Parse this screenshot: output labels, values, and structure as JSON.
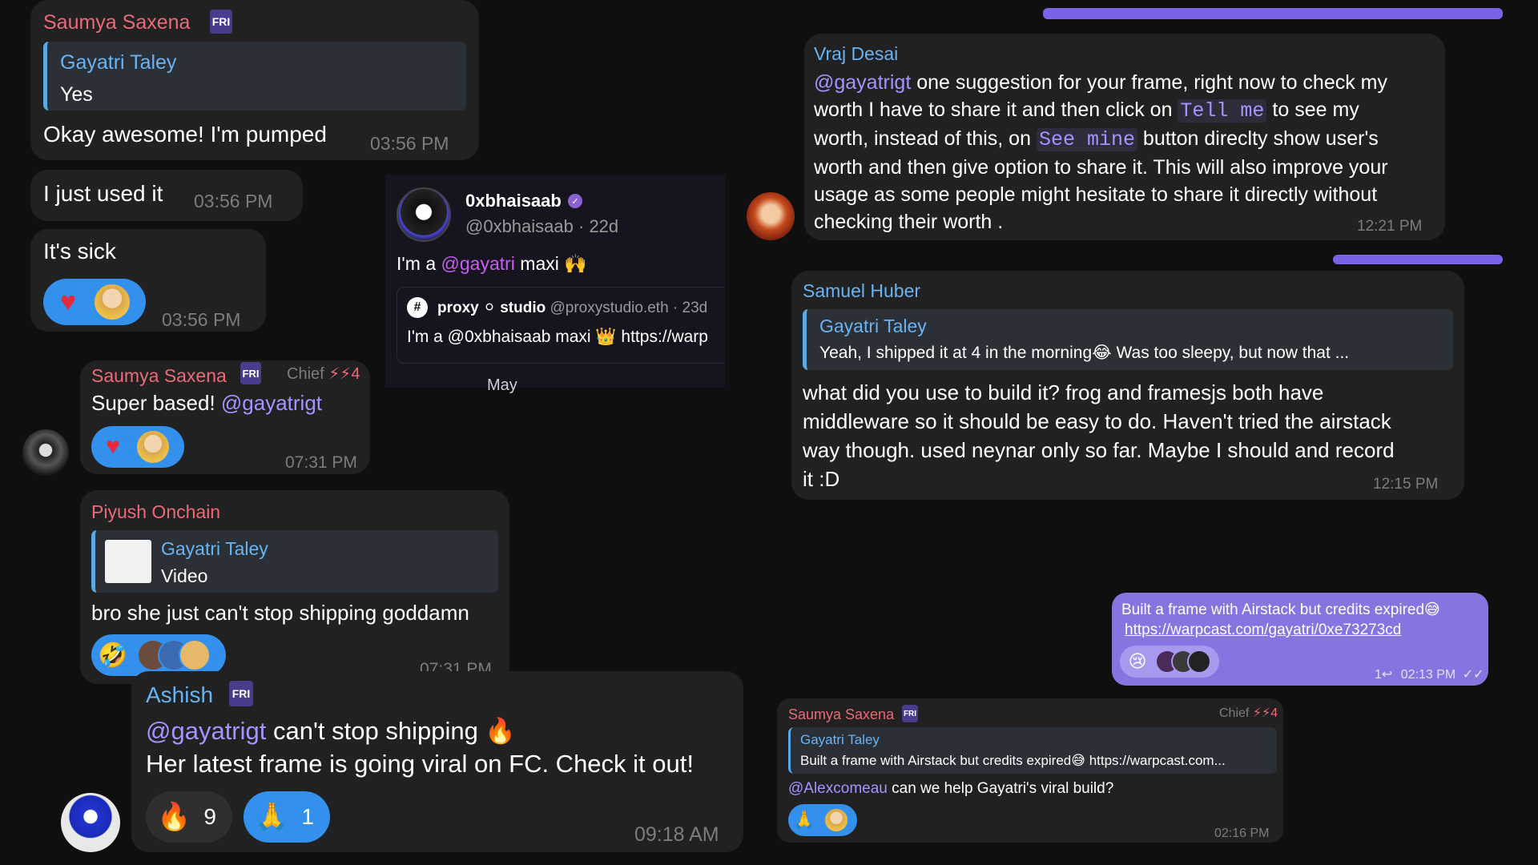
{
  "left": {
    "m1": {
      "name": "Saumya Saxena",
      "reply_name": "Gayatri Taley",
      "reply_text": "Yes",
      "text": "Okay awesome! I'm pumped",
      "time": "03:56 PM"
    },
    "m2": {
      "text": "I just used it",
      "time": "03:56 PM"
    },
    "m3": {
      "text": "It's sick",
      "time": "03:56 PM",
      "reactions": [
        "heart-emoji",
        "avatar-gayatri"
      ]
    },
    "m4": {
      "name": "Saumya Saxena",
      "tag": "Chief",
      "tag_suffix": "4",
      "text": "Super based!",
      "mention": "@gayatrigt",
      "time": "07:31 PM",
      "reactions": [
        "heart-emoji",
        "avatar-gayatri"
      ]
    },
    "m5": {
      "name": "Piyush Onchain",
      "reply_name": "Gayatri Taley",
      "reply_text": "Video",
      "text": "bro she just can't stop shipping goddamn",
      "time": "07:31 PM",
      "reactions": [
        "rofl-emoji",
        "avatar-stack"
      ]
    },
    "m6": {
      "name": "Ashish",
      "mention": "@gayatrigt",
      "line1": "can't stop shipping 🔥",
      "line2": "Her latest frame is going viral on FC. Check it out!",
      "time": "09:18 AM",
      "r1_emoji": "🔥",
      "r1_count": "9",
      "r2_emoji": "🙏",
      "r2_count": "1"
    }
  },
  "cast": {
    "author": "0xbhaisaab",
    "handle": "@0xbhaisaab",
    "age": "22d",
    "text_pre": "I'm a ",
    "mention": "@gayatri",
    "text_post": " maxi 🙌",
    "quote_author": "proxy ⚪ studio",
    "quote_handle": "@proxystudio.eth",
    "quote_age": "23d",
    "quote_text": "I'm a @0xbhaisaab maxi 👑 https://warp",
    "below_text": "May"
  },
  "right": {
    "m1": {
      "name": "Vraj Desai",
      "mention": "@gayatrigt",
      "t1": " one suggestion for your frame, right now to check my",
      "t2a": "worth I have to share it and then click on ",
      "code1": "Tell me",
      "t2b": " to see my",
      "t3a": "worth, instead of this, on ",
      "code2": "See mine",
      "t3b": " button direclty show user's",
      "t4": "worth and then give option to share it. This will also improve your",
      "t5": "usage as some people might hesitate to share it directly without",
      "t6": "checking their worth .",
      "time": "12:21 PM"
    },
    "m2": {
      "name": "Samuel Huber",
      "reply_name": "Gayatri Taley",
      "reply_text": "Yeah, I shipped it at 4 in the morning😂 Was too sleepy, but now that ...",
      "l1": "what did you use to build it? frog and framesjs both have",
      "l2": "middleware so it should be easy to do. Haven't tried the airstack",
      "l3": "way though. used neynar only so far. Maybe I should and record",
      "l4": "it :D",
      "time": "12:15 PM"
    },
    "m3": {
      "text": "Built a frame with Airstack but credits expired😅",
      "link": "https://warpcast.com/gayatri/0xe73273cd",
      "replies": "1",
      "time": "02:13 PM",
      "reactions": [
        "sad-emoji",
        "avatar-stack"
      ]
    },
    "m4": {
      "name": "Saumya Saxena",
      "tag": "Chief",
      "tag_suffix": "4",
      "reply_name": "Gayatri Taley",
      "reply_text": "Built a frame with Airstack but credits expired😅 https://warpcast.com...",
      "mention": "@Alexcomeau",
      "text": " can we help Gayatri's viral build?",
      "time": "02:16 PM",
      "reactions": [
        "pray-emoji",
        "avatar-gayatri"
      ]
    }
  },
  "colors": {
    "bubble": "#212121",
    "own_bubble": "#8774e1",
    "reaction": "#3390ec",
    "name_red": "#e96a78",
    "name_blue": "#6ab3f3"
  }
}
